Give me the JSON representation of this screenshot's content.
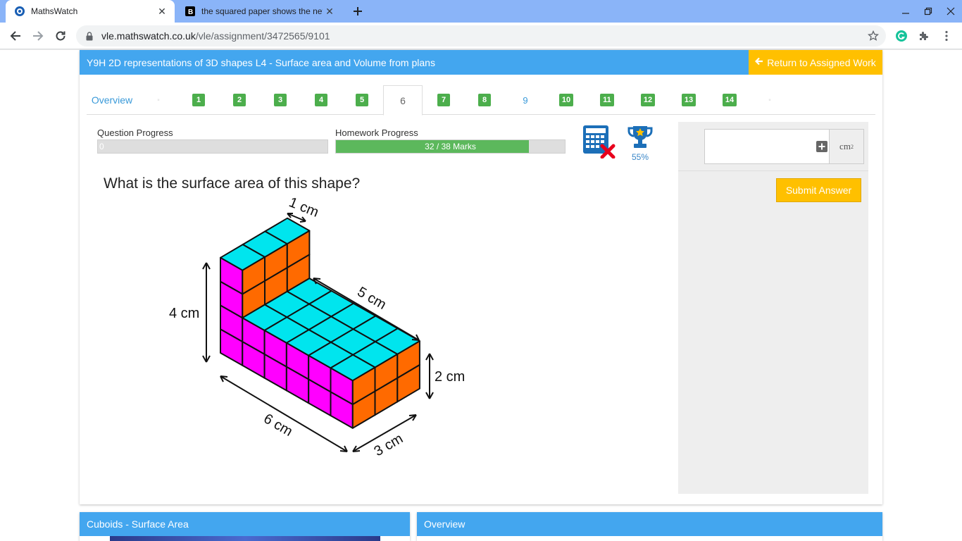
{
  "browser": {
    "tabs": [
      {
        "title": "MathsWatch",
        "active": true
      },
      {
        "title": "the squared paper shows the net",
        "active": false
      }
    ],
    "url_host": "vle.mathswatch.co.uk",
    "url_path": "/vle/assignment/3472565/9101"
  },
  "header": {
    "title": "Y9H 2D representations of 3D shapes L4 - Surface area and Volume from plans",
    "return_label": "Return to Assigned Work"
  },
  "question_tabs": {
    "overview": "Overview",
    "items": [
      {
        "label": "1",
        "state": "done"
      },
      {
        "label": "2",
        "state": "done"
      },
      {
        "label": "3",
        "state": "done"
      },
      {
        "label": "4",
        "state": "done"
      },
      {
        "label": "5",
        "state": "done"
      },
      {
        "label": "6",
        "state": "active"
      },
      {
        "label": "7",
        "state": "done"
      },
      {
        "label": "8",
        "state": "done"
      },
      {
        "label": "9",
        "state": "plain"
      },
      {
        "label": "10",
        "state": "done"
      },
      {
        "label": "11",
        "state": "done"
      },
      {
        "label": "12",
        "state": "done"
      },
      {
        "label": "13",
        "state": "done"
      },
      {
        "label": "14",
        "state": "done"
      }
    ]
  },
  "progress": {
    "question_label": "Question Progress",
    "question_value": "0",
    "question_fraction": 0,
    "homework_label": "Homework Progress",
    "homework_text": "32 / 38 Marks",
    "homework_fraction": 0.8421,
    "trophy_percent": "55%"
  },
  "question": {
    "text": "What is the surface area of this shape?",
    "labels": {
      "top_depth": "1 cm",
      "height": "4 cm",
      "back_length": "5 cm",
      "front_height": "2 cm",
      "length": "6 cm",
      "width": "3 cm"
    }
  },
  "answer": {
    "value": "",
    "unit": "cm",
    "unit_power": "2",
    "submit_label": "Submit Answer"
  },
  "bottom": {
    "left_title": "Cuboids - Surface Area",
    "right_title": "Overview"
  },
  "icons": {
    "calculator": "calculator-disabled-icon",
    "trophy": "trophy-icon"
  },
  "colors": {
    "header_blue": "#43a6ef",
    "accent_yellow": "#ffc000",
    "badge_green": "#4cae4c",
    "cube_top": "#00e5ee",
    "cube_front": "#ff00ff",
    "cube_side": "#ff6a00"
  }
}
